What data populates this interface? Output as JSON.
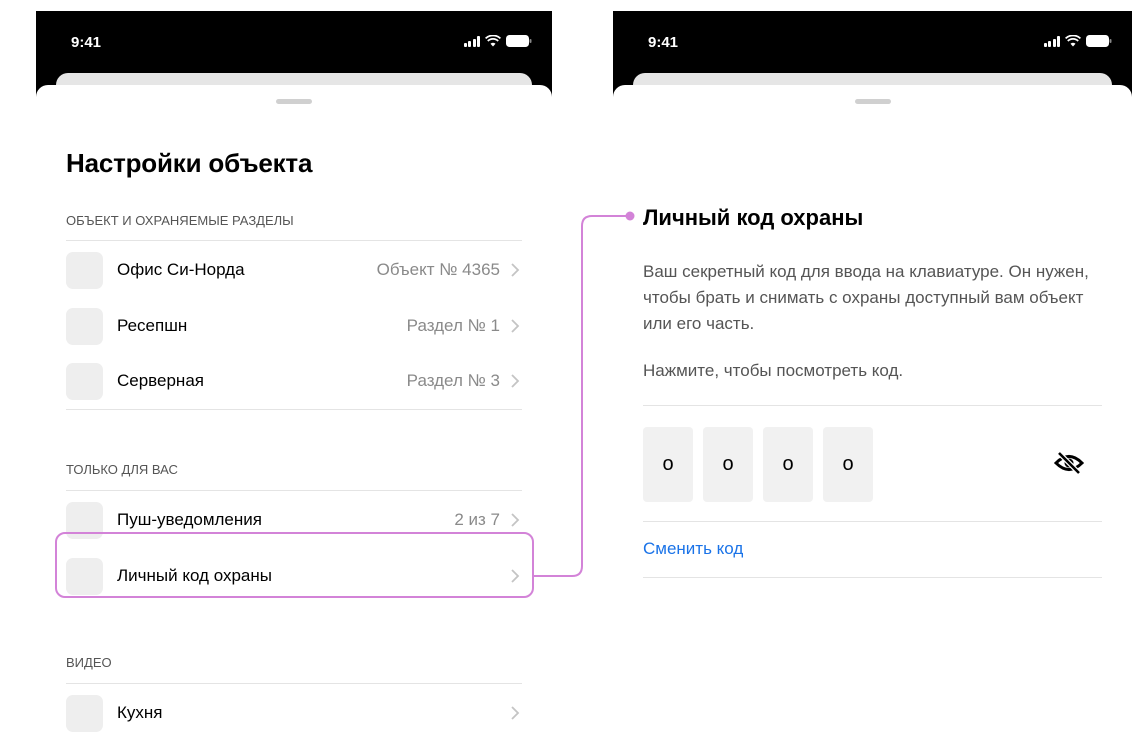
{
  "status_bar": {
    "time_left": "9:41",
    "time_right": "9:41"
  },
  "left_screen": {
    "title": "Настройки объекта",
    "sections": [
      {
        "header": "ОБЪЕКТ И ОХРАНЯЕМЫЕ РАЗДЕЛЫ",
        "items": [
          {
            "label": "Офис Си-Норда",
            "value": "Объект № 4365"
          },
          {
            "label": "Ресепшн",
            "value": "Раздел № 1"
          },
          {
            "label": "Серверная",
            "value": "Раздел № 3"
          }
        ]
      },
      {
        "header": "ТОЛЬКО ДЛЯ ВАС",
        "items": [
          {
            "label": "Пуш-уведомления",
            "value": "2 из 7"
          },
          {
            "label": "Личный код охраны",
            "value": ""
          }
        ]
      },
      {
        "header": "ВИДЕО",
        "items": [
          {
            "label": "Кухня",
            "value": ""
          }
        ]
      }
    ]
  },
  "right_screen": {
    "title": "Личный код охраны",
    "description": "Ваш секретный код для ввода на клавиатуре. Он нужен, чтобы брать и снимать с охраны доступный вам объект или его часть.",
    "hint": "Нажмите, чтобы посмотреть код.",
    "pin_digits": [
      "o",
      "o",
      "o",
      "o"
    ],
    "change_code_label": "Сменить код"
  },
  "colors": {
    "highlight": "#d383d8",
    "link": "#1a73e8",
    "status_bar_bg": "#000000"
  },
  "icons": [
    "signal-icon",
    "wifi-icon",
    "battery-icon",
    "chevron-right-icon",
    "eye-slash-icon"
  ]
}
